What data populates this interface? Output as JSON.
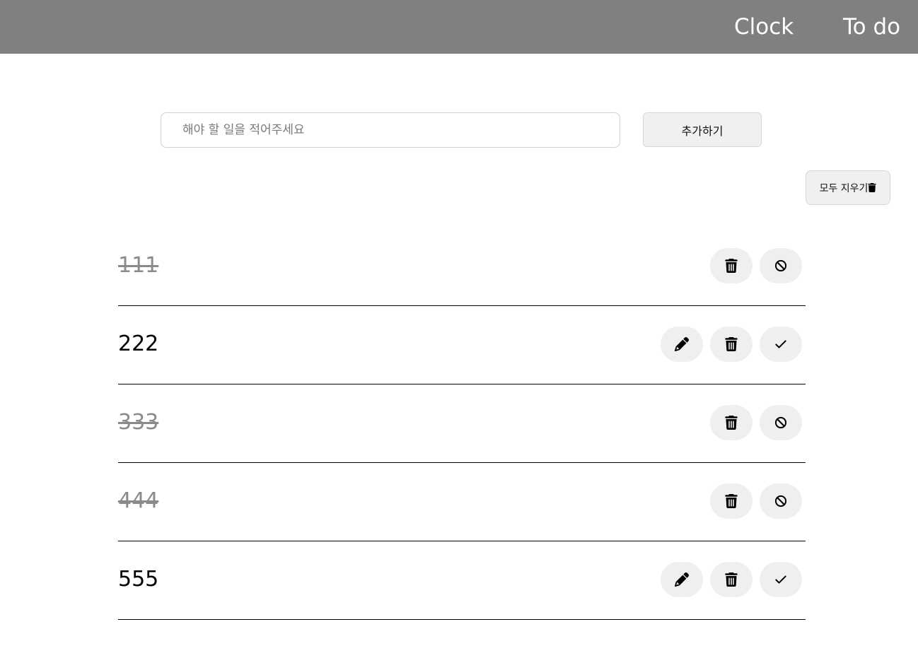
{
  "nav": {
    "clock_label": "Clock",
    "todo_label": "To do"
  },
  "form": {
    "input_placeholder": "해야 할 일을 적어주세요",
    "input_value": "",
    "add_label": "추가하기"
  },
  "clear_all_label": "모두 지우기",
  "todos": [
    {
      "text": "111",
      "done": true
    },
    {
      "text": "222",
      "done": false
    },
    {
      "text": "333",
      "done": true
    },
    {
      "text": "444",
      "done": true
    },
    {
      "text": "555",
      "done": false
    }
  ],
  "icons": {
    "edit": "pencil-icon",
    "delete": "trash-icon",
    "complete": "check-icon",
    "undo": "ban-icon",
    "clear_all": "trash-icon"
  },
  "colors": {
    "header_bg": "#808080",
    "done_text": "#8a8a8a",
    "button_bg": "#efefef"
  }
}
